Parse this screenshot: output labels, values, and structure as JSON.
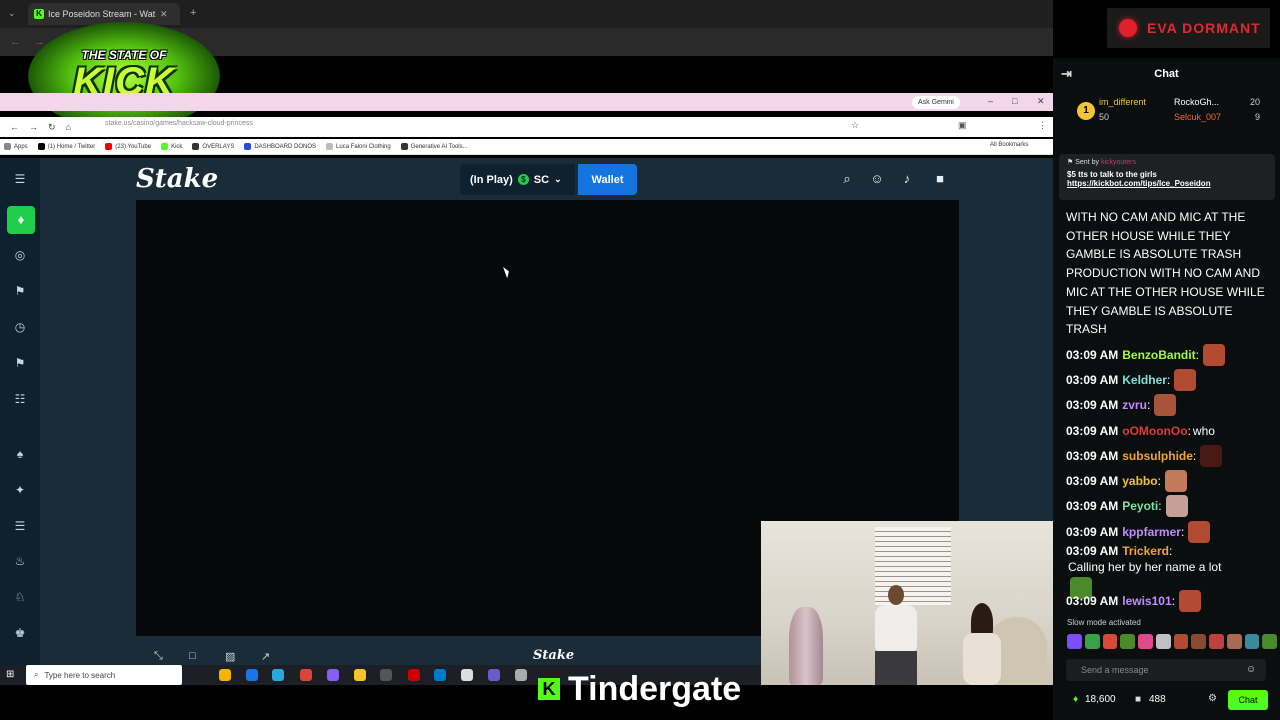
{
  "outer_browser": {
    "tab_title": "Ice Poseidon Stream - Wat...",
    "kick_favicon_letter": "K"
  },
  "logo": {
    "top_line": "THE STATE OF",
    "main": "KICK"
  },
  "status_badge": {
    "text": "EVA DORMANT",
    "color": "#e02a33"
  },
  "inner_browser": {
    "url": "stake.us/casino/games/hacksaw-cloud-princess",
    "ask_gemini": "Ask Gemini",
    "all_bookmarks": "All Bookmarks",
    "bookmarks": [
      {
        "label": "Apps",
        "color": "#888"
      },
      {
        "label": "(1) Home / Twitter",
        "color": "#000"
      },
      {
        "label": "(23) YouTube",
        "color": "#e00"
      },
      {
        "label": "Kick",
        "color": "#53fc18"
      },
      {
        "label": "OVERLAYS",
        "color": "#333"
      },
      {
        "label": "DASHBOARD DONOS",
        "color": "#2a4bd7"
      },
      {
        "label": "Luca Faloni Clothing",
        "color": "#bbb"
      },
      {
        "label": "Generative AI Tools...",
        "color": "#333"
      }
    ]
  },
  "stake": {
    "logo": "Stake",
    "in_play": "(In Play)",
    "currency": "SC",
    "wallet": "Wallet",
    "footer_logo": "Stake"
  },
  "taskbar": {
    "search_placeholder": "Type here to search"
  },
  "caption": {
    "k": "K",
    "text": "Tindergate"
  },
  "chat": {
    "title": "Chat",
    "top_chatters": [
      {
        "name": "im_different",
        "count": "50"
      },
      {
        "name": "RockoGh...",
        "count": "20"
      },
      {
        "name": "Selcuk_007",
        "count": "9"
      }
    ],
    "rank_badge": "1",
    "pinned": {
      "sent_by": "Sent by",
      "sender": "kickyouters",
      "message": "$5 tts to talk to the girls",
      "link": "https://kickbot.com/tips/Ice_Poseidon"
    },
    "big_message": "WITH NO CAM AND MIC AT THE OTHER HOUSE WHILE THEY GAMBLE IS ABSOLUTE TRASH PRODUCTION WITH NO CAM AND MIC AT THE OTHER HOUSE WHILE THEY GAMBLE IS ABSOLUTE TRASH",
    "messages": [
      {
        "time": "03:09 AM",
        "user": "BenzoBandit",
        "color": "#9efc3a",
        "text": "",
        "emote": "#b34a32"
      },
      {
        "time": "03:09 AM",
        "user": "Keldher",
        "color": "#7ee0d6",
        "text": "",
        "emote": "#b34a32"
      },
      {
        "time": "03:09 AM",
        "user": "zvru",
        "color": "#c08cff",
        "text": "",
        "emote": "#a8543a"
      },
      {
        "time": "03:09 AM",
        "user": "oOMoonOo",
        "color": "#e03a3a",
        "text": "who",
        "emote": ""
      },
      {
        "time": "03:09 AM",
        "user": "subsulphide",
        "color": "#f3a534",
        "text": "",
        "emote": "#4a1a12"
      },
      {
        "time": "03:09 AM",
        "user": "yabbo",
        "color": "#f3c334",
        "text": "",
        "emote": "#c27a5a"
      },
      {
        "time": "03:09 AM",
        "user": "Peyoti",
        "color": "#7ee0a0",
        "text": "",
        "emote": "#c4a098"
      },
      {
        "time": "03:09 AM",
        "user": "kppfarmer",
        "color": "#c08cff",
        "text": "",
        "emote": "#b34a32"
      },
      {
        "time": "03:09 AM",
        "user": "Trickerd",
        "color": "#f3a534",
        "text": "Calling her by her name a lot",
        "emote": "#4a8a2a"
      },
      {
        "time": "03:09 AM",
        "user": "lewis101",
        "color": "#c08cff",
        "text": "",
        "emote": "#b34a32"
      }
    ],
    "slow_mode": "Slow mode activated",
    "send_placeholder": "Send a message",
    "followers": "18,600",
    "viewers": "488",
    "chat_button": "Chat"
  }
}
